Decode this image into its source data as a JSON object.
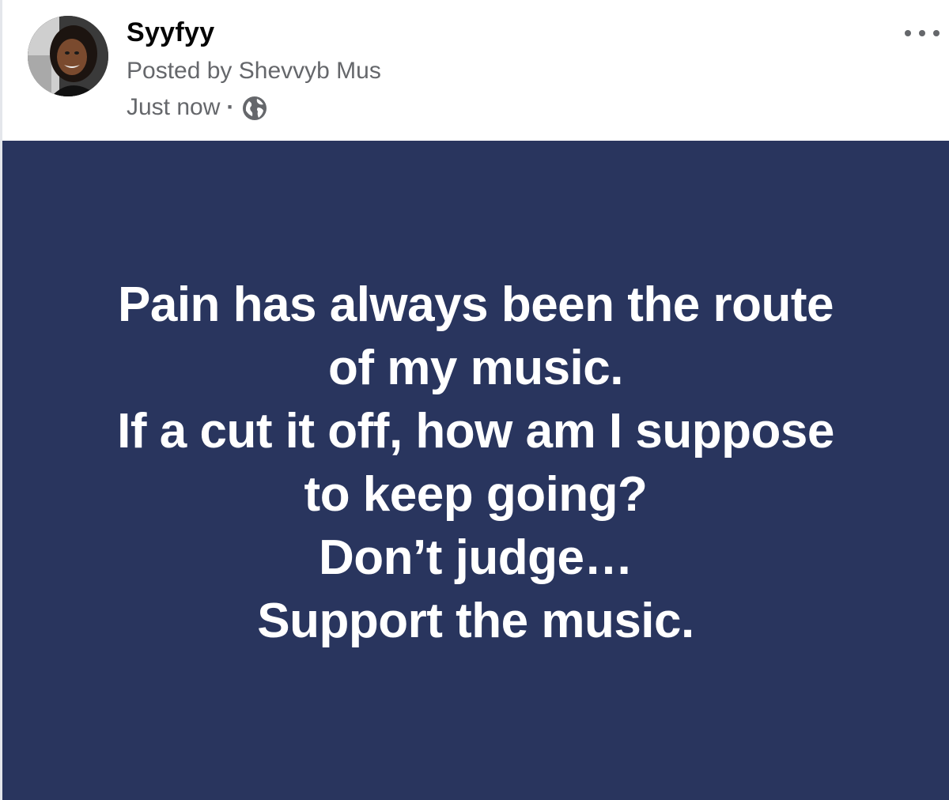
{
  "post": {
    "page_name": "Syyfyy",
    "posted_by": "Posted by Shevvyb Mus",
    "timestamp": "Just now",
    "separator": "·",
    "privacy_icon": "globe-icon",
    "more_icon": "more-options-icon",
    "avatar_icon": "profile-avatar"
  },
  "text_card": {
    "background_color": "#29355e",
    "text_color": "#ffffff",
    "lines": [
      "Pain has always been the route",
      "of my music.",
      "If a cut it off, how am I suppose",
      "to keep going?",
      "Don’t judge…",
      "Support the music."
    ]
  }
}
